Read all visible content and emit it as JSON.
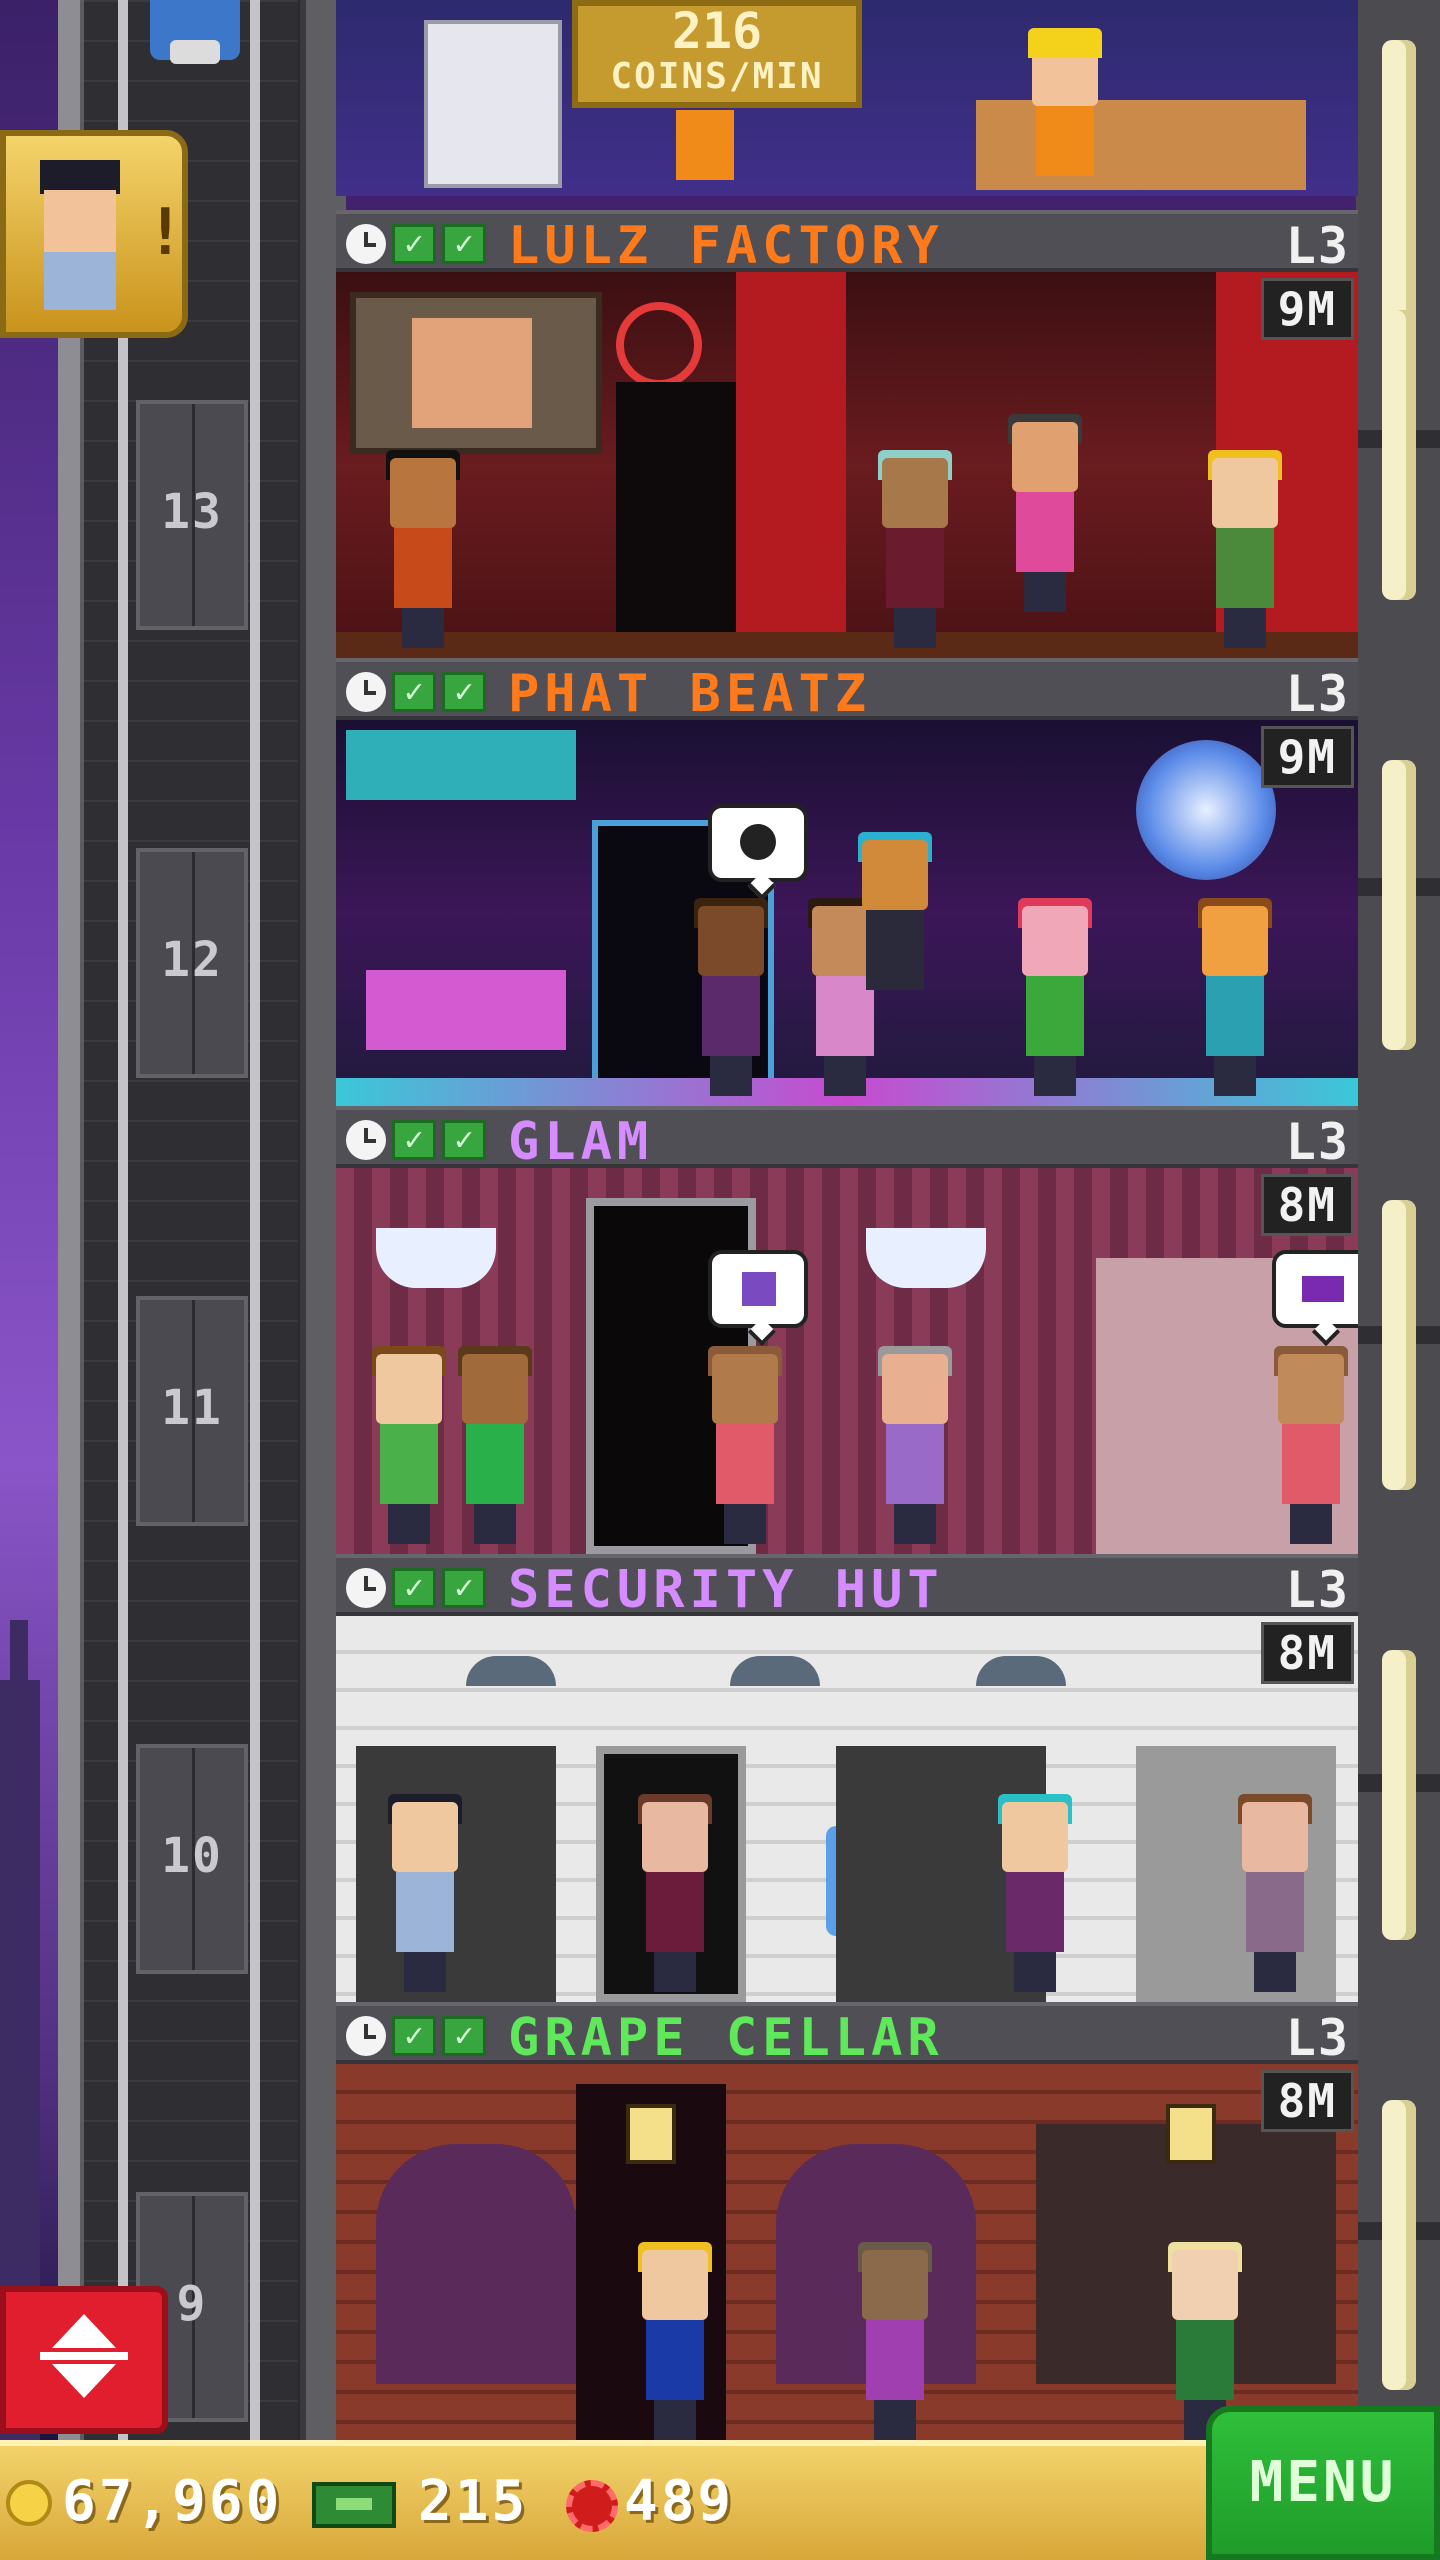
{
  "header": {
    "coins_per_min_value": "216",
    "coins_per_min_unit": "COINS/MIN"
  },
  "shaft": {
    "floor_numbers": [
      "13",
      "12",
      "11",
      "10",
      "9"
    ]
  },
  "floors": [
    {
      "name": "LULZ FACTORY",
      "level": "L3",
      "time": "9M",
      "name_color": "#ff7a1a"
    },
    {
      "name": "PHAT BEATZ",
      "level": "L3",
      "time": "9M",
      "name_color": "#ff7a1a"
    },
    {
      "name": "GLAM",
      "level": "L3",
      "time": "8M",
      "name_color": "#d48cff"
    },
    {
      "name": "SECURITY HUT",
      "level": "L3",
      "time": "8M",
      "name_color": "#d48cff"
    },
    {
      "name": "GRAPE CELLAR",
      "level": "L3",
      "time": "8M",
      "name_color": "#5fe85a"
    }
  ],
  "status": {
    "coins": "67,960",
    "bux": "215",
    "points": "489"
  },
  "buttons": {
    "menu": "MENU"
  },
  "icons": {
    "clock": "clock-icon",
    "check": "check-icon",
    "coins": "coin-icon",
    "bux": "bux-icon",
    "points": "gear-icon",
    "updown": "elevator-up-down-icon",
    "notify": "security-guard-avatar-icon"
  }
}
